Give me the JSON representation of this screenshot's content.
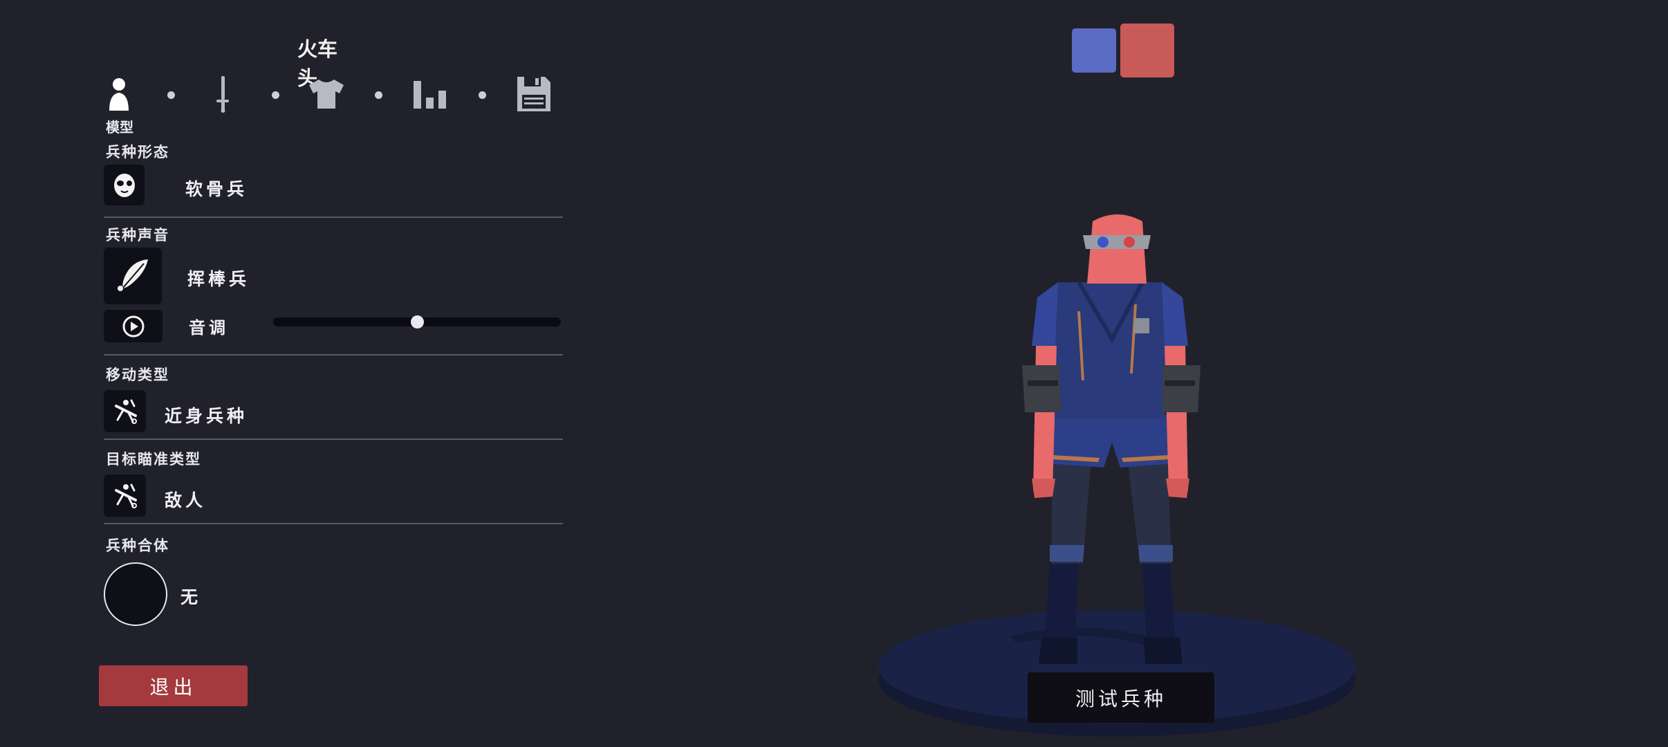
{
  "header": {
    "unit_name": "火车头"
  },
  "tabs": [
    {
      "icon": "person-icon",
      "label": "模型",
      "active": true
    },
    {
      "icon": "sword-icon",
      "label": ""
    },
    {
      "icon": "shirt-icon",
      "label": ""
    },
    {
      "icon": "stats-icon",
      "label": ""
    },
    {
      "icon": "save-icon",
      "label": ""
    }
  ],
  "sections": {
    "unit_form": {
      "title": "兵种形态",
      "value": "软骨兵",
      "icon": "mask-face-icon"
    },
    "unit_voice": {
      "title": "兵种声音",
      "value": "挥棒兵",
      "icon": "feather-icon",
      "pitch_label": "音调",
      "pitch_value": 0.5,
      "play_icon": "play-icon"
    },
    "movement_type": {
      "title": "移动类型",
      "value": "近身兵种",
      "icon": "melee-movement-icon"
    },
    "targeting_type": {
      "title": "目标瞄准类型",
      "value": "敌人",
      "icon": "target-enemy-icon"
    },
    "unit_merge": {
      "title": "兵种合体",
      "value": "无"
    }
  },
  "buttons": {
    "exit": "退出",
    "test_unit": "测试兵种"
  },
  "teams": [
    {
      "name": "blue-team",
      "color": "#5b6cc4"
    },
    {
      "name": "red-team",
      "color": "#c85a58",
      "selected": true
    }
  ],
  "colors": {
    "background": "#21212b",
    "exit_button": "#a43a3d",
    "panel_box": "#0f0f17"
  }
}
